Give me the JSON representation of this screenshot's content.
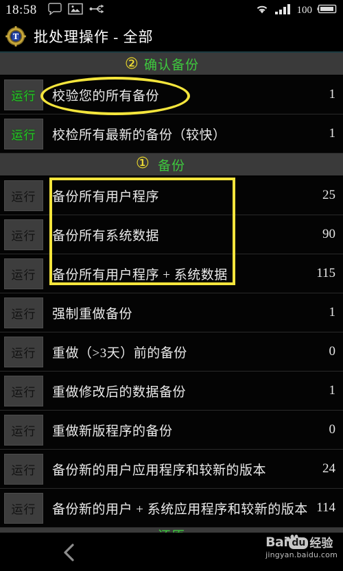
{
  "statusbar": {
    "clock": "18:58",
    "battery_percent": "100",
    "icons": [
      "chat-bubble-icon",
      "gallery-image-icon",
      "usb-icon",
      "wifi-icon",
      "cellular-signal-icon",
      "battery-icon"
    ]
  },
  "titlebar": {
    "app_icon": "titanium-backup-gear-icon",
    "title": "批处理操作 - 全部"
  },
  "colors": {
    "section_green": "#3ec93e",
    "annotation_yellow": "#f4e53c",
    "run_enabled_green": "#25c425",
    "row_background": "#040404",
    "section_background": "#3a3a3a"
  },
  "list": [
    {
      "kind": "section",
      "name": "section-confirm-backup",
      "label": "确认备份",
      "annotation": "②"
    },
    {
      "kind": "row",
      "run_label": "运行",
      "run_enabled": true,
      "label": "校验您的所有备份",
      "count": "1",
      "annotated": "ellipse"
    },
    {
      "kind": "row",
      "run_label": "运行",
      "run_enabled": true,
      "label": "校检所有最新的备份（较快）",
      "count": "1",
      "annotated": ""
    },
    {
      "kind": "section",
      "name": "section-backup",
      "label": "备份",
      "annotation": "①"
    },
    {
      "kind": "row",
      "run_label": "运行",
      "run_enabled": false,
      "label": "备份所有用户程序",
      "count": "25",
      "annotated": "rect"
    },
    {
      "kind": "row",
      "run_label": "运行",
      "run_enabled": false,
      "label": "备份所有系统数据",
      "count": "90",
      "annotated": "rect"
    },
    {
      "kind": "row",
      "run_label": "运行",
      "run_enabled": false,
      "label": "备份所有用户程序 + 系统数据",
      "count": "115",
      "annotated": "rect"
    },
    {
      "kind": "row",
      "run_label": "运行",
      "run_enabled": false,
      "label": "强制重做备份",
      "count": "1",
      "annotated": ""
    },
    {
      "kind": "row",
      "run_label": "运行",
      "run_enabled": false,
      "label": "重做（>3天）前的备份",
      "count": "0",
      "annotated": ""
    },
    {
      "kind": "row",
      "run_label": "运行",
      "run_enabled": false,
      "label": "重做修改后的数据备份",
      "count": "1",
      "annotated": ""
    },
    {
      "kind": "row",
      "run_label": "运行",
      "run_enabled": false,
      "label": "重做新版程序的备份",
      "count": "0",
      "annotated": ""
    },
    {
      "kind": "row",
      "run_label": "运行",
      "run_enabled": false,
      "label": "备份新的用户应用程序和较新的版本",
      "count": "24",
      "annotated": ""
    },
    {
      "kind": "row",
      "run_label": "运行",
      "run_enabled": false,
      "label": "备份新的用户 + 系统应用程序和较新的版本",
      "count": "114",
      "annotated": ""
    },
    {
      "kind": "section-clipped",
      "name": "section-restore",
      "label": "还原",
      "annotation": ""
    }
  ],
  "navbar": {
    "back_icon": "back-chevron-icon",
    "watermark": {
      "bai": "Bai",
      "du": "du",
      "cn": "经验",
      "url": "jingyan.baidu.com"
    }
  }
}
